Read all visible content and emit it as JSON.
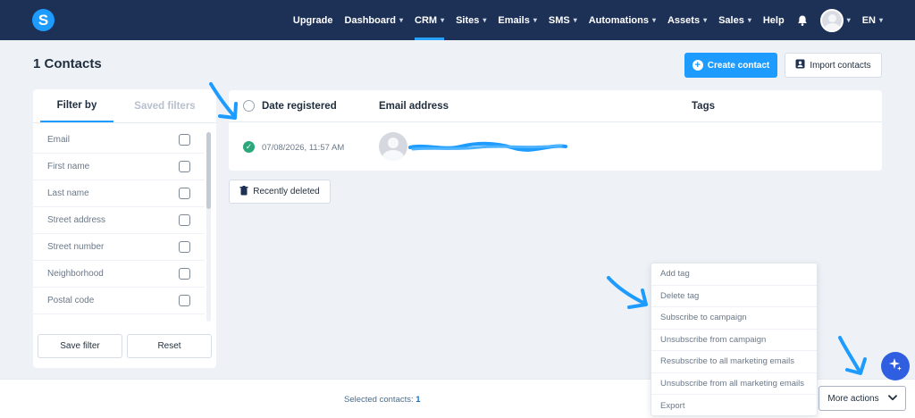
{
  "nav": {
    "logo": "S",
    "items": [
      {
        "label": "Upgrade",
        "dropdown": false,
        "active": false
      },
      {
        "label": "Dashboard",
        "dropdown": true,
        "active": false
      },
      {
        "label": "CRM",
        "dropdown": true,
        "active": true
      },
      {
        "label": "Sites",
        "dropdown": true,
        "active": false
      },
      {
        "label": "Emails",
        "dropdown": true,
        "active": false
      },
      {
        "label": "SMS",
        "dropdown": true,
        "active": false
      },
      {
        "label": "Automations",
        "dropdown": true,
        "active": false
      },
      {
        "label": "Assets",
        "dropdown": true,
        "active": false
      },
      {
        "label": "Sales",
        "dropdown": true,
        "active": false
      },
      {
        "label": "Help",
        "dropdown": false,
        "active": false
      }
    ],
    "language": "EN"
  },
  "header": {
    "title": "1 Contacts",
    "create_label": "Create contact",
    "import_label": "Import contacts"
  },
  "filter": {
    "tabs": [
      "Filter by",
      "Saved filters"
    ],
    "fields": [
      "Email",
      "First name",
      "Last name",
      "Street address",
      "Street number",
      "Neighborhood",
      "Postal code"
    ],
    "save_label": "Save filter",
    "reset_label": "Reset"
  },
  "table": {
    "columns": [
      "Date registered",
      "Email address",
      "Tags"
    ],
    "rows": [
      {
        "date": "07/08/2026, 11:57 AM",
        "email": "",
        "tags": ""
      }
    ]
  },
  "recently_deleted_label": "Recently deleted",
  "bottom": {
    "selected_label": "Selected contacts:",
    "selected_count": "1",
    "more_actions_label": "More actions"
  },
  "menu": {
    "items": [
      "Add tag",
      "Delete tag",
      "Subscribe to campaign",
      "Unsubscribe from campaign",
      "Resubscribe to all marketing emails",
      "Unsubscribe from all marketing emails",
      "Export"
    ]
  },
  "colors": {
    "nav_bg": "#1d3156",
    "accent": "#1e9bff",
    "success": "#2aa87a",
    "annotation": "#1e9bff"
  },
  "icons": {
    "bell": "bell-icon",
    "create": "plus-circle-icon",
    "import": "contact-card-icon",
    "recently_deleted": "trash-icon",
    "more_actions": "chevron-down-icon",
    "fab": "sparkle-icon"
  }
}
